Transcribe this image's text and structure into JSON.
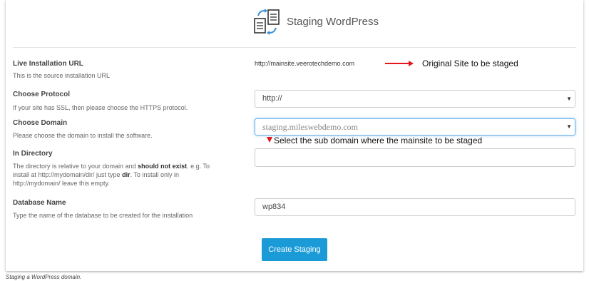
{
  "header": {
    "title": "Staging WordPress",
    "icon": "staging-documents-icon"
  },
  "rows": {
    "live_url": {
      "label": "Live Installation URL",
      "help": "This is the source installation URL",
      "value": "http://mainsite.veerotechdemo.com",
      "note": "Original Site to be staged"
    },
    "protocol": {
      "label": "Choose Protocol",
      "help": "If your site has SSL, then please choose the HTTPS protocol.",
      "selected": "http://"
    },
    "domain": {
      "label": "Choose Domain",
      "help": "Please choose the domain to install the software.",
      "selected": "staging.mileswebdemo.com",
      "note": "Select the sub domain where the mainsite to be staged"
    },
    "directory": {
      "label": "In Directory",
      "help_1": "The directory is relative to your domain and ",
      "help_bold_1": "should not exist",
      "help_2": ". e.g. To install at http://mydomain/dir/ just type ",
      "help_bold_2": "dir",
      "help_3": ". To install only in http://mydomain/ leave this empty.",
      "value": ""
    },
    "database": {
      "label": "Database Name",
      "help": "Type the name of the database to be created for the installation",
      "value": "wp834"
    }
  },
  "submit_label": "Create Staging",
  "caption": "Staging a WordPress domain.",
  "colors": {
    "accent": "#1a9bd7",
    "annotation": "#e4161b",
    "focus": "#66afe9"
  }
}
